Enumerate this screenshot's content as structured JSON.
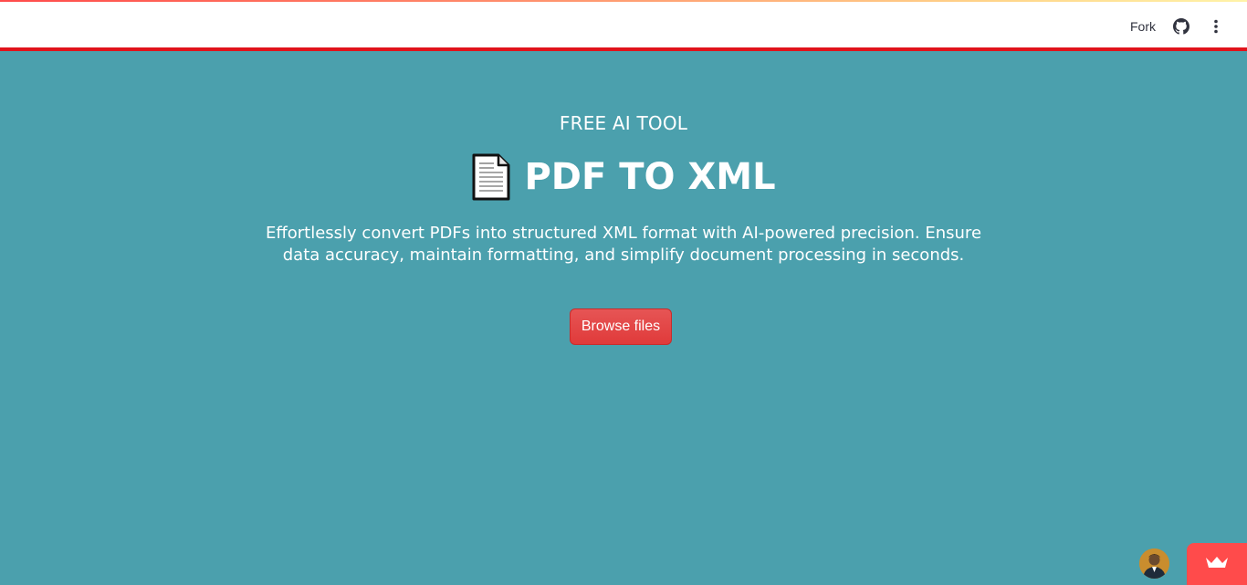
{
  "header": {
    "fork_label": "Fork",
    "github_icon": "github-icon",
    "menu_icon": "vertical-dots-icon"
  },
  "main": {
    "eyebrow": "FREE AI TOOL",
    "doc_icon": "page-document-icon",
    "title": "PDF TO XML",
    "description": "Effortlessly convert PDFs into structured XML format with AI-powered precision. Ensure data accuracy, maintain formatting, and simplify document processing in seconds.",
    "browse_label": "Browse files"
  },
  "footer": {
    "avatar": "user-avatar",
    "badge_icon": "crown-icon"
  },
  "colors": {
    "background": "#4ba0ad",
    "header_border": "#e0131a",
    "button": "#e03a3a",
    "badge": "#ff4b4b"
  }
}
